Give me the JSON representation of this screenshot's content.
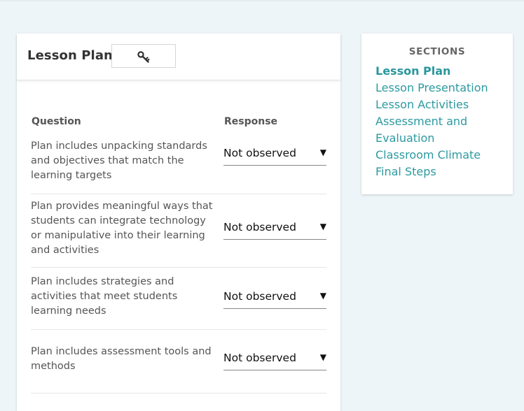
{
  "lesson_plan": {
    "title": "Lesson Plan",
    "key_button_icon": "key-icon"
  },
  "table": {
    "question_header": "Question",
    "response_header": "Response",
    "rows": [
      {
        "question": "Plan includes unpacking standards and objectives that match the learning targets",
        "response": "Not observed"
      },
      {
        "question": "Plan provides meaningful ways that students can integrate technology or manipulative into their learning and activities",
        "response": "Not observed"
      },
      {
        "question": "Plan includes strategies and activities that meet students learning needs",
        "response": "Not observed"
      },
      {
        "question": "Plan includes assessment tools and methods",
        "response": "Not observed"
      }
    ]
  },
  "sections": {
    "title": "SECTIONS",
    "items": [
      "Lesson Plan",
      "Lesson Presentation",
      "Lesson Activities",
      "Assessment and Evaluation",
      "Classroom Climate",
      "Final Steps"
    ],
    "active_index": 0
  },
  "colors": {
    "accent": "#2c9aa0",
    "background": "#eef5f8"
  }
}
